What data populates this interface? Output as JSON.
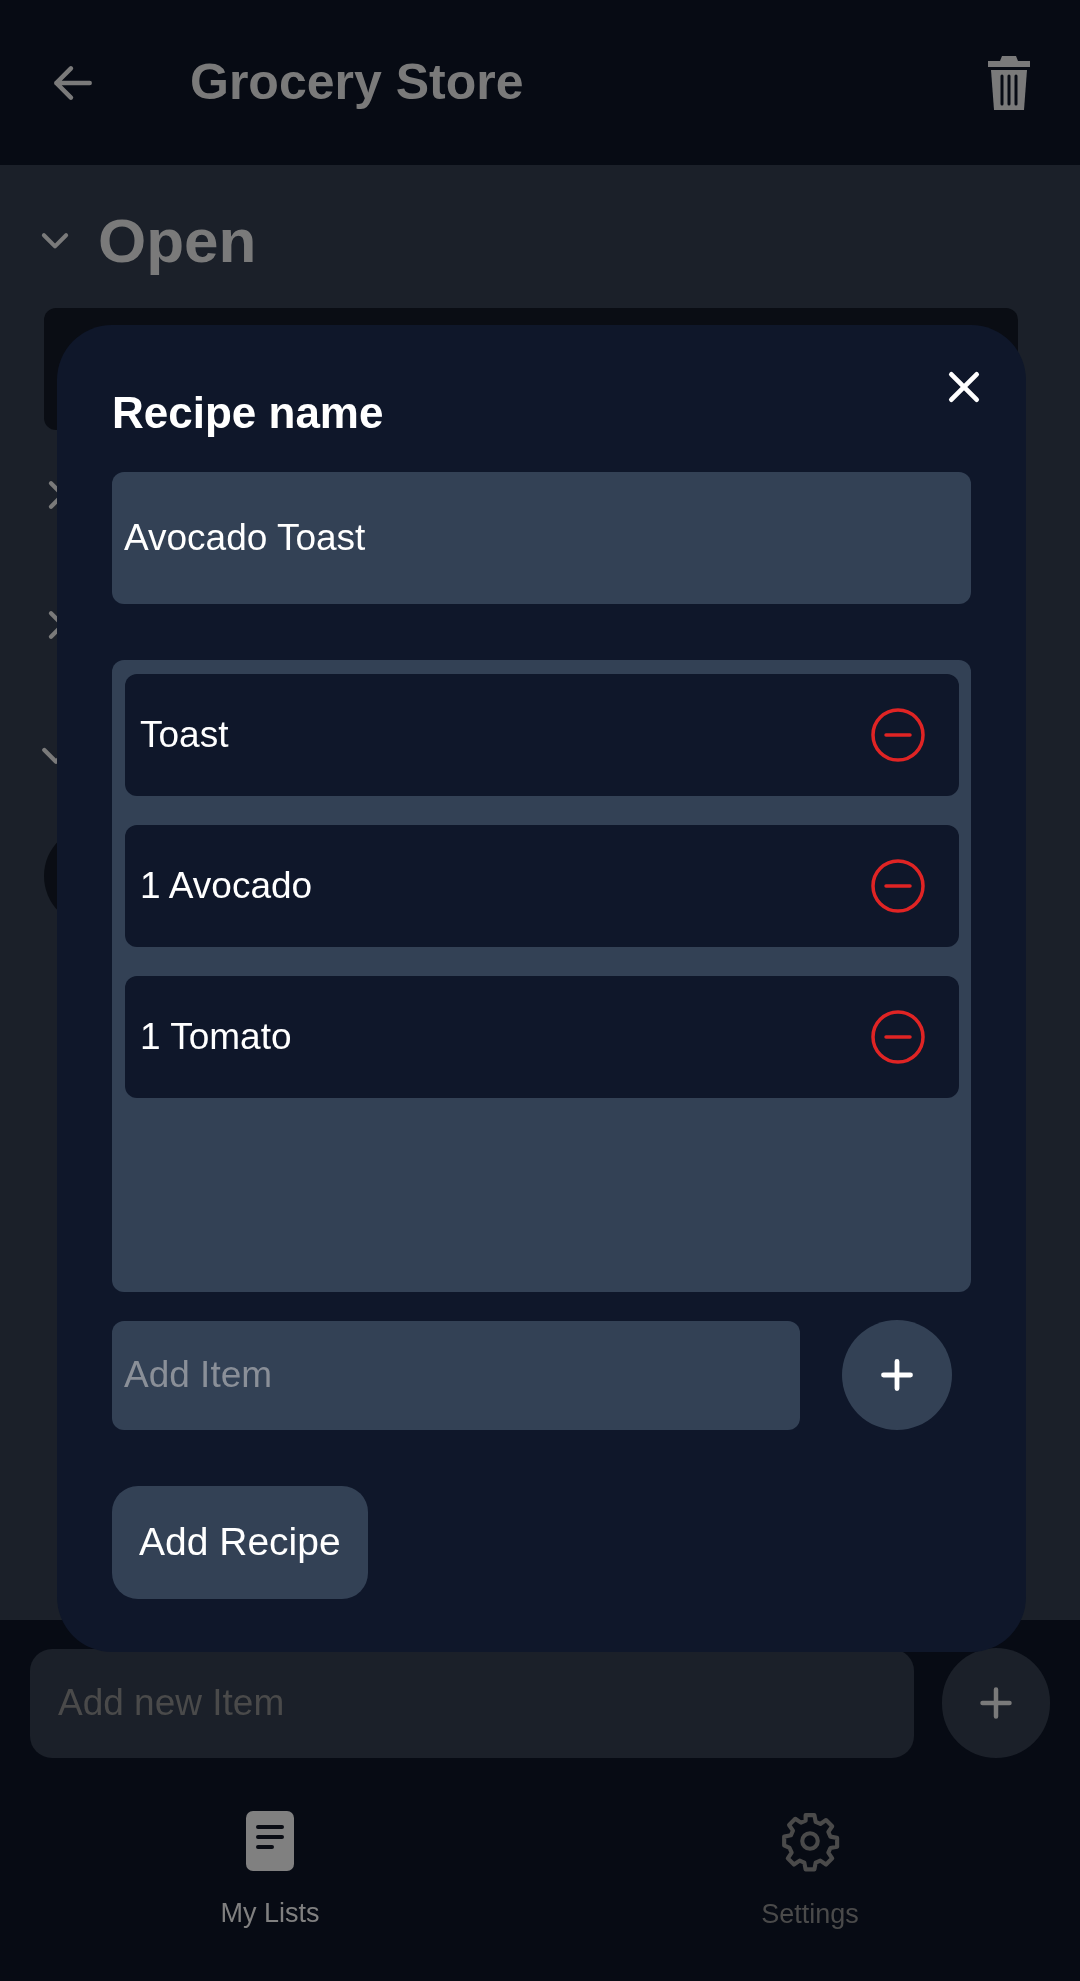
{
  "header": {
    "title": "Grocery Store"
  },
  "sections": [
    {
      "title": "Open",
      "expanded": true
    },
    {
      "expanded": false
    },
    {
      "expanded": false
    },
    {
      "expanded": true
    }
  ],
  "dialog": {
    "title": "Recipe name",
    "name_value": "Avocado Toast",
    "items": [
      {
        "text": "Toast"
      },
      {
        "text": "1 Avocado"
      },
      {
        "text": "1 Tomato"
      }
    ],
    "add_item": {
      "placeholder": "Add Item"
    },
    "submit": "Add Recipe"
  },
  "add_new_item": {
    "placeholder": "Add new Item"
  },
  "nav": [
    {
      "label": "My Lists",
      "kind": "document",
      "selected": true
    },
    {
      "label": "Settings",
      "kind": "gear",
      "selected": false
    }
  ]
}
